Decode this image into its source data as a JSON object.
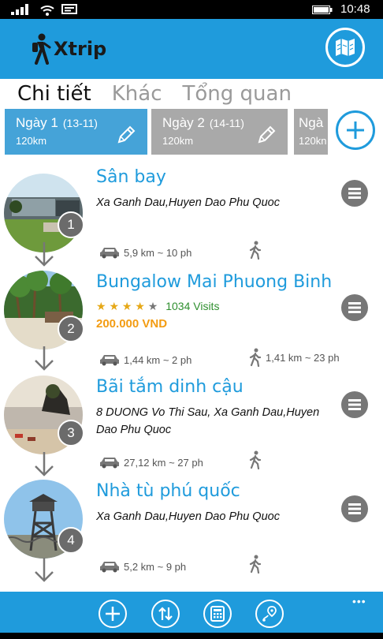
{
  "status_bar": {
    "time": "10:48"
  },
  "app": {
    "name": "Xtrip"
  },
  "tabs": [
    {
      "label": "Chi tiết",
      "active": true
    },
    {
      "label": "Khác",
      "active": false
    },
    {
      "label": "Tổng quan",
      "active": false
    }
  ],
  "days": [
    {
      "label": "Ngày 1",
      "date": "(13-11)",
      "distance": "120km",
      "active": true
    },
    {
      "label": "Ngày 2",
      "date": "(14-11)",
      "distance": "120km",
      "active": false
    },
    {
      "label": "Ngà",
      "date": "",
      "distance": "120kn",
      "active": false
    }
  ],
  "places": [
    {
      "number": "1",
      "title": "Sân bay",
      "address": "Xa Ganh Dau,Huyen Dao Phu Quoc",
      "car_route": "5,9 km ~ 10 ph",
      "walk_route": ""
    },
    {
      "number": "2",
      "title": "Bungalow Mai Phuong Binh",
      "rating_stars": 4,
      "visits": "1034 Visits",
      "price": "200.000 VND",
      "car_route": "1,44 km ~ 2 ph",
      "walk_route": "1,41 km ~ 23 ph"
    },
    {
      "number": "3",
      "title": "Bãi tắm dinh cậu",
      "address": "8 DUONG Vo Thi Sau, Xa Ganh Dau,Huyen Dao Phu Quoc",
      "car_route": "27,12 km ~ 27 ph",
      "walk_route": ""
    },
    {
      "number": "4",
      "title": "Nhà tù phú quốc",
      "address": "Xa Ganh Dau,Huyen Dao Phu Quoc",
      "car_route": "5,2 km ~ 9 ph",
      "walk_route": ""
    }
  ],
  "bottom_bar": {
    "buttons": [
      "add-icon",
      "reorder-icon",
      "calculator-icon",
      "map-route-icon"
    ],
    "more": "•••"
  },
  "colors": {
    "accent": "#1f9bdc",
    "active_day": "#45a3d8",
    "inactive_day": "#a9a9a9",
    "price": "#f39c12",
    "visits": "#2f8f2f"
  }
}
